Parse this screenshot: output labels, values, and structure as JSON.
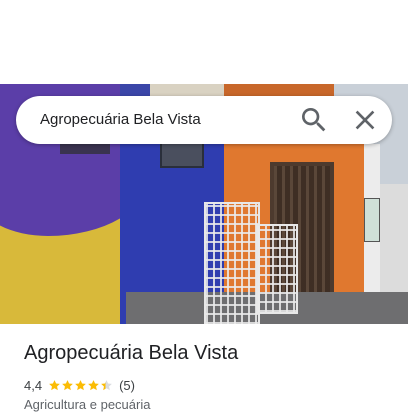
{
  "search": {
    "value": "Agropecuária Bela Vista",
    "search_icon": "search-icon",
    "close_icon": "close-icon"
  },
  "place": {
    "name": "Agropecuária Bela Vista",
    "rating": "4,4",
    "stars_value": 4.4,
    "stars_max": 5,
    "reviews": "(5)",
    "category": "Agricultura e pecuária"
  },
  "colors": {
    "star": "#fbbc04",
    "star_empty": "#dadce0",
    "text_primary": "#202124",
    "text_secondary": "#5f6368",
    "icon": "#5f6368"
  }
}
